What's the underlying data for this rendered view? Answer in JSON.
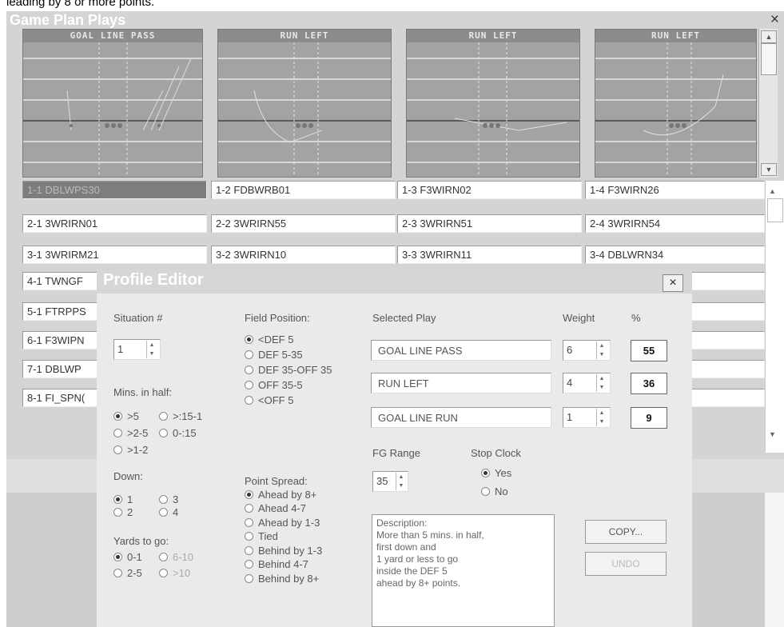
{
  "caption": "leading by 8 or more points.",
  "window": {
    "title": "Game Plan Plays",
    "close": "×"
  },
  "thumbnails": [
    {
      "label": "GOAL LINE PASS"
    },
    {
      "label": "RUN LEFT"
    },
    {
      "label": "RUN LEFT"
    },
    {
      "label": "RUN LEFT"
    }
  ],
  "grid": [
    [
      "1-1 DBLWPS30",
      "1-2 FDBWRB01",
      "1-3 F3WIRN02",
      "1-4 F3WIRN26"
    ],
    [
      "2-1 3WRIRN01",
      "2-2 3WRIRN55",
      "2-3 3WRIRN51",
      "2-4 3WRIRN54"
    ],
    [
      "3-1 3WRIRM21",
      "3-2 3WRIRN10",
      "3-3 3WRIRN11",
      "3-4 DBLWRN34"
    ],
    [
      "4-1 TWNGF"
    ],
    [
      "5-1 FTRPPS"
    ],
    [
      "6-1 F3WIPN"
    ],
    [
      "7-1 DBLWP"
    ],
    [
      "8-1 FI_SPN("
    ]
  ],
  "dialog": {
    "title": "Profile Editor",
    "close": "×",
    "situation_label": "Situation #",
    "situation_value": "1",
    "mins_label": "Mins. in half:",
    "mins_options": [
      ">5",
      ">:15-1",
      ">2-5",
      "0-:15",
      ">1-2"
    ],
    "down_label": "Down:",
    "down_options": [
      "1",
      "3",
      "2",
      "4"
    ],
    "yards_label": "Yards to go:",
    "yards_options": [
      "0-1",
      "6-10",
      "2-5",
      ">10"
    ],
    "field_label": "Field Position:",
    "field_options": [
      "<DEF 5",
      "DEF 5-35",
      "DEF 35-OFF 35",
      "OFF 35-5",
      "<OFF 5"
    ],
    "spread_label": "Point Spread:",
    "spread_options": [
      "Ahead by 8+",
      "Ahead 4-7",
      "Ahead by 1-3",
      "Tied",
      "Behind by 1-3",
      "Behind 4-7",
      "Behind by 8+"
    ],
    "selected_play_label": "Selected Play",
    "weight_label": "Weight",
    "percent_label": "%",
    "plays": [
      {
        "name": "GOAL LINE PASS",
        "weight": "6",
        "percent": "55"
      },
      {
        "name": "RUN LEFT",
        "weight": "4",
        "percent": "36"
      },
      {
        "name": "GOAL LINE RUN",
        "weight": "1",
        "percent": "9"
      }
    ],
    "fg_label": "FG Range",
    "fg_value": "35",
    "stop_clock_label": "Stop Clock",
    "stop_clock_options": [
      "Yes",
      "No"
    ],
    "description": [
      "Description:",
      "More than 5 mins. in half,",
      "first down and",
      "1 yard or less to go",
      "inside the DEF 5",
      "ahead by 8+ points."
    ],
    "copy_button": "COPY...",
    "undo_button": "UNDO"
  }
}
